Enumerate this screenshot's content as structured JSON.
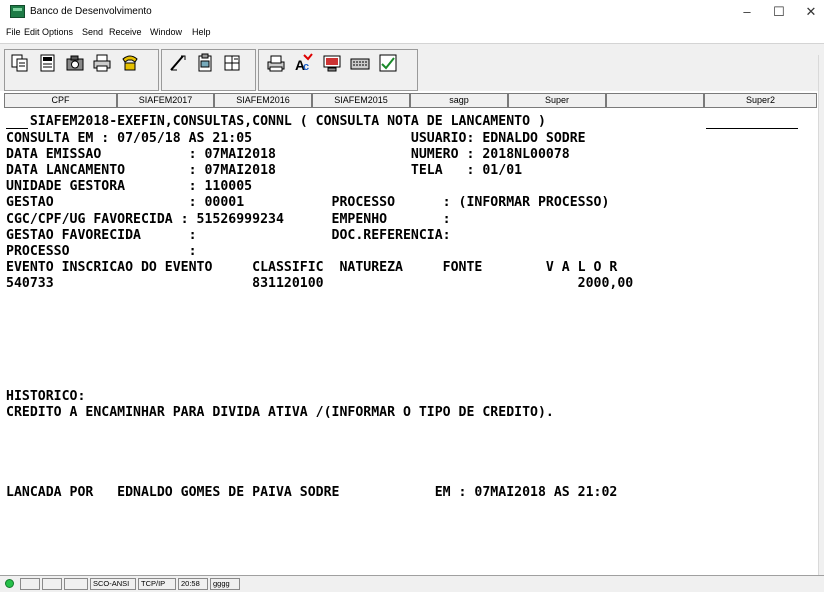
{
  "window": {
    "title": "Banco de Desenvolvimento",
    "minimize": "–",
    "maximize": "☐",
    "close": "✕"
  },
  "menu": [
    "File",
    "Edit",
    "Options",
    "Send",
    "Receive",
    "Window",
    "Help"
  ],
  "toolbar_icons": [
    "copy-icon",
    "document-icon",
    "camera-icon",
    "printer-icon",
    "phone-icon",
    "macro-icon",
    "clipboard-icon",
    "layout-icon",
    "print-screen-icon",
    "abc-icon",
    "monitor-icon",
    "keyboard-icon",
    "checklist-icon"
  ],
  "function_keys": [
    "CPF",
    "SIAFEM2017",
    "SIAFEM2016",
    "SIAFEM2015",
    "sagp",
    "Super",
    "",
    "Super2"
  ],
  "terminal": {
    "header": "   SIAFEM2018-EXEFIN,CONSULTAS,CONNL ( CONSULTA NOTA DE LANCAMENTO )",
    "lines": [
      "CONSULTA EM : 07/05/18 AS 21:05                    USUARIO: EDNALDO SODRE",
      "DATA EMISSAO           : 07MAI2018                 NUMERO : 2018NL00078",
      "DATA LANCAMENTO        : 07MAI2018                 TELA   : 01/01",
      "UNIDADE GESTORA        : 110005",
      "GESTAO                 : 00001           PROCESSO      : (INFORMAR PROCESSO)",
      "CGC/CPF/UG FAVORECIDA : 51526999234      EMPENHO       :",
      "GESTAO FAVORECIDA      :                 DOC.REFERENCIA:",
      "PROCESSO               :",
      "EVENTO INSCRICAO DO EVENTO     CLASSIFIC  NATUREZA     FONTE        V A L O R",
      "540733                         831120100                                2000,00",
      "",
      "",
      "",
      "",
      "",
      "",
      "HISTORICO:",
      "CREDITO A ENCAMINHAR PARA DIVIDA ATIVA /(INFORMAR O TIPO DE CREDITO).",
      "",
      "",
      "",
      "",
      "LANCADA POR   EDNALDO GOMES DE PAIVA SODRE            EM : 07MAI2018 AS 21:02"
    ]
  },
  "status": {
    "protocol": "SCO-ANSI",
    "connection": "TCP/IP",
    "time": "20:58",
    "code": "gggg"
  }
}
